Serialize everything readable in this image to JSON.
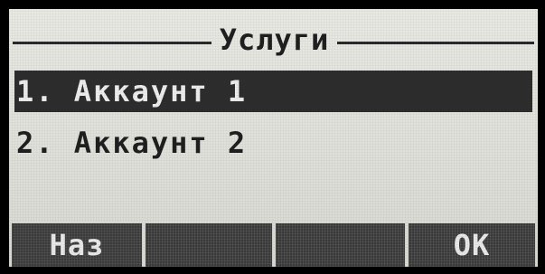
{
  "screen": {
    "title": "Услуги"
  },
  "menu": {
    "items": [
      {
        "label": "1. Аккаунт 1",
        "selected": true
      },
      {
        "label": "2. Аккаунт 2",
        "selected": false
      }
    ]
  },
  "softkeys": {
    "keys": [
      {
        "label": "Наз"
      },
      {
        "label": ""
      },
      {
        "label": ""
      },
      {
        "label": "ОК"
      }
    ]
  },
  "colors": {
    "lcd_background": "#e4e4de",
    "ink": "#1f1f1f",
    "highlight": "#2d2d2d",
    "softkey": "#3a3a3a"
  }
}
